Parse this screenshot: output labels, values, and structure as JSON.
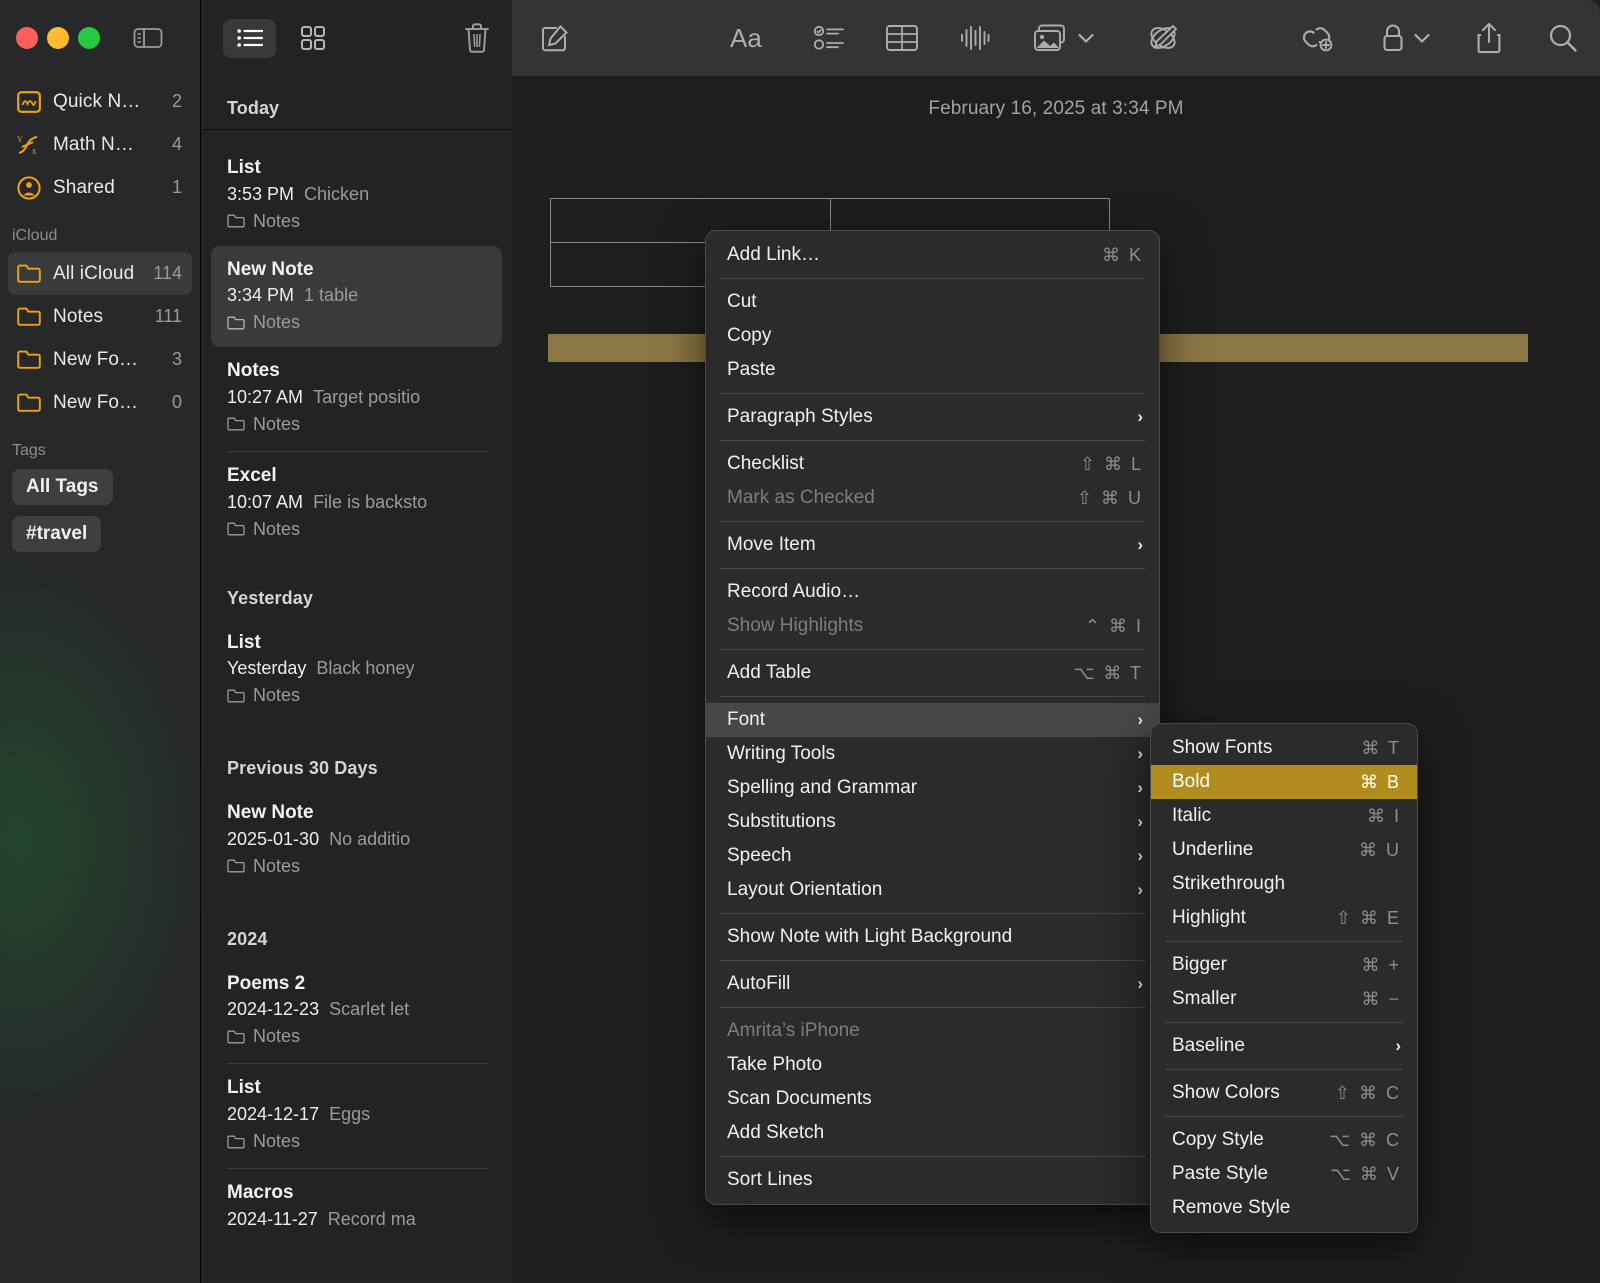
{
  "window": {
    "traffic_lights": [
      "close",
      "minimize",
      "zoom"
    ],
    "sidebar_toggle_icon": "sidebar-toggle-icon"
  },
  "sidebar": {
    "smart_folders": [
      {
        "label": "Quick N…",
        "count": "2",
        "icon": "quick-note-icon"
      },
      {
        "label": "Math N…",
        "count": "4",
        "icon": "math-notes-icon"
      },
      {
        "label": "Shared",
        "count": "1",
        "icon": "shared-person-icon"
      }
    ],
    "icloud_header": "iCloud",
    "folders": [
      {
        "label": "All iCloud",
        "count": "114",
        "icon": "folder-icon",
        "selected": true
      },
      {
        "label": "Notes",
        "count": "111",
        "icon": "folder-icon",
        "selected": false
      },
      {
        "label": "New Fo…",
        "count": "3",
        "icon": "folder-icon",
        "selected": false
      },
      {
        "label": "New Fo…",
        "count": "0",
        "icon": "folder-icon",
        "selected": false
      }
    ],
    "tags_header": "Tags",
    "tags": [
      "All Tags",
      "#travel"
    ],
    "accent_color": "#f0a30a"
  },
  "notelist": {
    "toolbar": {
      "list_view_icon": "list-view-icon",
      "gallery_view_icon": "gallery-view-icon",
      "trash_icon": "trash-icon"
    },
    "groups": [
      {
        "label": "Today",
        "items": [
          {
            "title": "List",
            "time": "3:53 PM",
            "snippet": "Chicken",
            "folder": "Notes",
            "selected": false,
            "separator": false
          },
          {
            "title": "New Note",
            "time": "3:34 PM",
            "snippet": "1 table",
            "folder": "Notes",
            "selected": true,
            "separator": false
          },
          {
            "title": "Notes",
            "time": "10:27 AM",
            "snippet": "Target positio",
            "folder": "Notes",
            "selected": false,
            "separator": true
          },
          {
            "title": "Excel",
            "time": "10:07 AM",
            "snippet": "File is backsto",
            "folder": "Notes",
            "selected": false,
            "separator": false
          }
        ]
      },
      {
        "label": "Yesterday",
        "items": [
          {
            "title": "List",
            "time": "Yesterday",
            "snippet": "Black honey",
            "folder": "Notes",
            "selected": false,
            "separator": false
          }
        ]
      },
      {
        "label": "Previous 30 Days",
        "items": [
          {
            "title": "New Note",
            "time": "2025-01-30",
            "snippet": "No additio",
            "folder": "Notes",
            "selected": false,
            "separator": false
          }
        ]
      },
      {
        "label": "2024",
        "items": [
          {
            "title": "Poems 2",
            "time": "2024-12-23",
            "snippet": "Scarlet let",
            "folder": "Notes",
            "selected": false,
            "separator": true
          },
          {
            "title": "List",
            "time": "2024-12-17",
            "snippet": "Eggs",
            "folder": "Notes",
            "selected": false,
            "separator": true
          },
          {
            "title": "Macros",
            "time": "2024-11-27",
            "snippet": "Record ma",
            "folder": "Notes",
            "selected": false,
            "separator": false
          }
        ]
      }
    ]
  },
  "editor": {
    "toolbar": [
      {
        "name": "compose-icon",
        "label": "Compose"
      },
      {
        "name": "format-text-icon",
        "label": "Aa"
      },
      {
        "name": "checklist-icon",
        "label": "Checklist"
      },
      {
        "name": "table-icon",
        "label": "Table"
      },
      {
        "name": "audio-waveform-icon",
        "label": "Record Audio"
      },
      {
        "name": "media-icon",
        "label": "Media"
      },
      {
        "name": "markup-icon",
        "label": "Markup"
      },
      {
        "name": "add-link-icon",
        "label": "Add Link"
      },
      {
        "name": "lock-icon",
        "label": "Lock Note"
      },
      {
        "name": "share-icon",
        "label": "Share"
      },
      {
        "name": "search-icon",
        "label": "Search"
      }
    ],
    "date": "February 16, 2025 at 3:34 PM",
    "table": {
      "rows": 2,
      "cols": 2,
      "cells": [
        [
          "",
          ""
        ],
        [
          "",
          ""
        ]
      ]
    },
    "highlight_color": "#8c7845"
  },
  "context_menu": {
    "items": [
      {
        "label": "Add Link…",
        "key": "⌘ K",
        "type": "item"
      },
      {
        "type": "sep"
      },
      {
        "label": "Cut",
        "key": "",
        "type": "item"
      },
      {
        "label": "Copy",
        "key": "",
        "type": "item"
      },
      {
        "label": "Paste",
        "key": "",
        "type": "item"
      },
      {
        "type": "sep"
      },
      {
        "label": "Paragraph Styles",
        "key": "",
        "type": "submenu"
      },
      {
        "type": "sep"
      },
      {
        "label": "Checklist",
        "key": "⇧ ⌘ L",
        "type": "item"
      },
      {
        "label": "Mark as Checked",
        "key": "⇧ ⌘ U",
        "type": "item",
        "disabled": true
      },
      {
        "type": "sep"
      },
      {
        "label": "Move Item",
        "key": "",
        "type": "submenu"
      },
      {
        "type": "sep"
      },
      {
        "label": "Record Audio…",
        "key": "",
        "type": "item"
      },
      {
        "label": "Show Highlights",
        "key": "⌃ ⌘ I",
        "type": "item",
        "disabled": true
      },
      {
        "type": "sep"
      },
      {
        "label": "Add Table",
        "key": "⌥ ⌘ T",
        "type": "item"
      },
      {
        "type": "sep"
      },
      {
        "label": "Font",
        "key": "",
        "type": "submenu",
        "hover": true
      },
      {
        "label": "Writing Tools",
        "key": "",
        "type": "submenu"
      },
      {
        "label": "Spelling and Grammar",
        "key": "",
        "type": "submenu"
      },
      {
        "label": "Substitutions",
        "key": "",
        "type": "submenu"
      },
      {
        "label": "Speech",
        "key": "",
        "type": "submenu"
      },
      {
        "label": "Layout Orientation",
        "key": "",
        "type": "submenu"
      },
      {
        "type": "sep"
      },
      {
        "label": "Show Note with Light Background",
        "key": "",
        "type": "item"
      },
      {
        "type": "sep"
      },
      {
        "label": "AutoFill",
        "key": "",
        "type": "submenu"
      },
      {
        "type": "sep"
      },
      {
        "label": "Amrita’s iPhone",
        "key": "",
        "type": "item",
        "disabled": true
      },
      {
        "label": "Take Photo",
        "key": "",
        "type": "item"
      },
      {
        "label": "Scan Documents",
        "key": "",
        "type": "item"
      },
      {
        "label": "Add Sketch",
        "key": "",
        "type": "item"
      },
      {
        "type": "sep"
      },
      {
        "label": "Sort Lines",
        "key": "",
        "type": "item"
      }
    ]
  },
  "font_submenu": {
    "items": [
      {
        "label": "Show Fonts",
        "key": "⌘ T",
        "type": "item"
      },
      {
        "label": "Bold",
        "key": "⌘ B",
        "type": "item",
        "selected": true
      },
      {
        "label": "Italic",
        "key": "⌘ I",
        "type": "item"
      },
      {
        "label": "Underline",
        "key": "⌘ U",
        "type": "item"
      },
      {
        "label": "Strikethrough",
        "key": "",
        "type": "item"
      },
      {
        "label": "Highlight",
        "key": "⇧ ⌘ E",
        "type": "item"
      },
      {
        "type": "sep"
      },
      {
        "label": "Bigger",
        "key": "⌘ +",
        "type": "item"
      },
      {
        "label": "Smaller",
        "key": "⌘ −",
        "type": "item"
      },
      {
        "type": "sep"
      },
      {
        "label": "Baseline",
        "key": "",
        "type": "submenu"
      },
      {
        "type": "sep"
      },
      {
        "label": "Show Colors",
        "key": "⇧ ⌘ C",
        "type": "item"
      },
      {
        "type": "sep"
      },
      {
        "label": "Copy Style",
        "key": "⌥ ⌘ C",
        "type": "item"
      },
      {
        "label": "Paste Style",
        "key": "⌥ ⌘ V",
        "type": "item"
      },
      {
        "label": "Remove Style",
        "key": "",
        "type": "item"
      }
    ],
    "selected_color": "#b08d1e"
  }
}
